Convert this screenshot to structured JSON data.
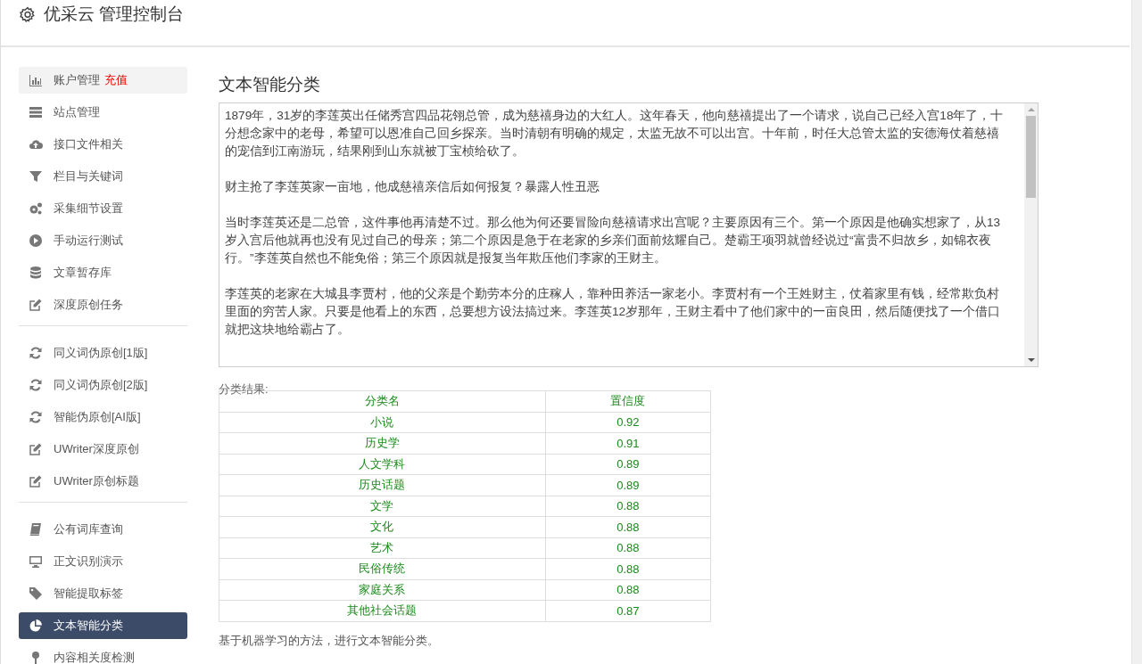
{
  "header": {
    "title": "优采云 管理控制台"
  },
  "sidebar": {
    "groups": [
      [
        {
          "label": "账户管理",
          "badge": "充值",
          "selected": false,
          "hovered": true
        },
        {
          "label": "站点管理",
          "selected": false,
          "hovered": false
        },
        {
          "label": "接口文件相关",
          "selected": false,
          "hovered": false
        },
        {
          "label": "栏目与关键词",
          "selected": false,
          "hovered": false
        },
        {
          "label": "采集细节设置",
          "selected": false,
          "hovered": false
        },
        {
          "label": "手动运行测试",
          "selected": false,
          "hovered": false
        },
        {
          "label": "文章暂存库",
          "selected": false,
          "hovered": false
        },
        {
          "label": "深度原创任务",
          "selected": false,
          "hovered": false
        }
      ],
      [
        {
          "label": "同义词伪原创[1版]",
          "selected": false,
          "hovered": false
        },
        {
          "label": "同义词伪原创[2版]",
          "selected": false,
          "hovered": false
        },
        {
          "label": "智能伪原创[AI版]",
          "selected": false,
          "hovered": false
        },
        {
          "label": "UWriter深度原创",
          "selected": false,
          "hovered": false
        },
        {
          "label": "UWriter原创标题",
          "selected": false,
          "hovered": false
        }
      ],
      [
        {
          "label": "公有词库查询",
          "selected": false,
          "hovered": false
        },
        {
          "label": "正文识别演示",
          "selected": false,
          "hovered": false
        },
        {
          "label": "智能提取标签",
          "selected": false,
          "hovered": false
        },
        {
          "label": "文本智能分类",
          "selected": true,
          "hovered": false
        },
        {
          "label": "内容相关度检测",
          "selected": false,
          "hovered": false
        }
      ]
    ]
  },
  "main": {
    "title": "文本智能分类",
    "text_input": {
      "paragraphs": [
        "1879年，31岁的李莲英出任储秀宫四品花翎总管，成为慈禧身边的大红人。这年春天，他向慈禧提出了一个请求，说自己已经入宫18年了，十分想念家中的老母，希望可以恩准自己回乡探亲。当时清朝有明确的规定，太监无故不可以出宫。十年前，时任大总管太监的安德海仗着慈禧的宠信到江南游玩，结果刚到山东就被丁宝桢给砍了。",
        "财主抢了李莲英家一亩地，他成慈禧亲信后如何报复？暴露人性丑恶",
        "当时李莲英还是二总管，这件事他再清楚不过。那么他为何还要冒险向慈禧请求出宫呢？主要原因有三个。第一个原因是他确实想家了，从13岁入宫后他就再也没有见过自己的母亲；第二个原因是急于在老家的乡亲们面前炫耀自己。楚霸王项羽就曾经说过“富贵不归故乡，如锦衣夜行。”李莲英自然也不能免俗；第三个原因就是报复当年欺压他们李家的王财主。",
        "李莲英的老家在大城县李贾村，他的父亲是个勤劳本分的庄稼人，靠种田养活一家老小。李贾村有一个王姓财主，仗着家里有钱，经常欺负村里面的穷苦人家。只要是他看上的东西，总要想方设法搞过来。李莲英12岁那年，王财主看中了他们家中的一亩良田，然后随便找了一个借口就把这块地给霸占了。"
      ]
    },
    "result_label": "分类结果:",
    "table": {
      "columns": [
        "分类名",
        "置信度"
      ],
      "rows": [
        [
          "小说",
          "0.92"
        ],
        [
          "历史学",
          "0.91"
        ],
        [
          "人文学科",
          "0.89"
        ],
        [
          "历史话题",
          "0.89"
        ],
        [
          "文学",
          "0.88"
        ],
        [
          "文化",
          "0.88"
        ],
        [
          "艺术",
          "0.88"
        ],
        [
          "民俗传统",
          "0.88"
        ],
        [
          "家庭关系",
          "0.88"
        ],
        [
          "其他社会话题",
          "0.87"
        ]
      ]
    },
    "note": "基于机器学习的方法，进行文本智能分类。"
  }
}
